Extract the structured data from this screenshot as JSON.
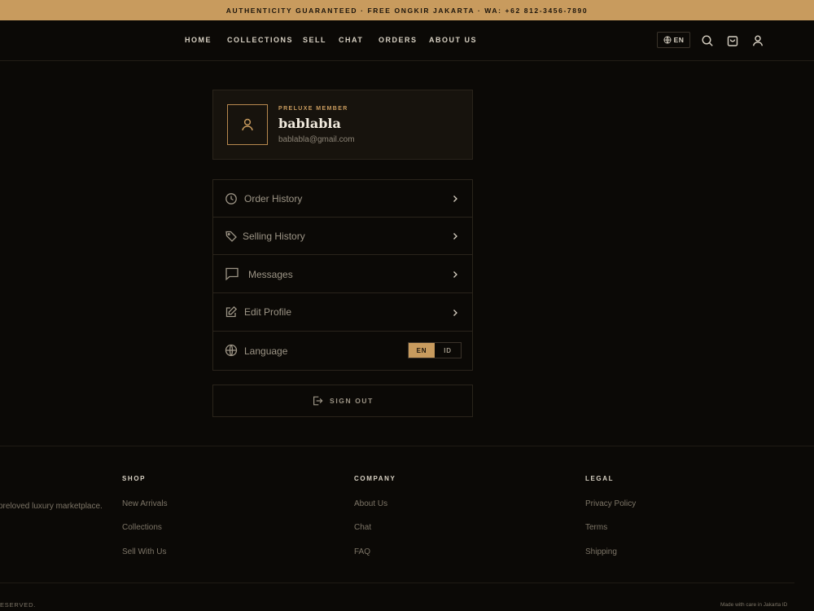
{
  "announcement": "AUTHENTICITY GUARANTEED · FREE ONGKIR JAKARTA · WA: +62 812-3456-7890",
  "nav": {
    "home": "HOME",
    "collections": "COLLECTIONS",
    "sell": "SELL",
    "chat": "CHAT",
    "orders": "ORDERS",
    "about": "ABOUT US"
  },
  "header": {
    "language": "EN",
    "icons": [
      "globe-icon",
      "search-icon",
      "bag-icon",
      "user-icon"
    ]
  },
  "profile": {
    "badge": "PRELUXE MEMBER",
    "name": "bablabla",
    "email": "bablabla@gmail.com"
  },
  "menu": {
    "order_history": "Order History",
    "selling_history": "Selling History",
    "messages": "Messages",
    "edit_profile": "Edit Profile",
    "language": "Language",
    "lang_en": "EN",
    "lang_id": "ID",
    "selected_language": "EN"
  },
  "signout": "SIGN OUT",
  "footer": {
    "tagline": "preloved luxury marketplace.",
    "shop": {
      "title": "SHOP",
      "links": [
        "New Arrivals",
        "Collections",
        "Sell With Us"
      ]
    },
    "company": {
      "title": "COMPANY",
      "links": [
        "About Us",
        "Chat",
        "FAQ"
      ]
    },
    "legal": {
      "title": "LEGAL",
      "links": [
        "Privacy Policy",
        "Terms",
        "Shipping"
      ]
    },
    "copyright": "ESERVED.",
    "made": "Made with care in Jakarta ID"
  },
  "colors": {
    "accent": "#c89b5e",
    "background": "#0b0906",
    "card": "#17130d"
  }
}
